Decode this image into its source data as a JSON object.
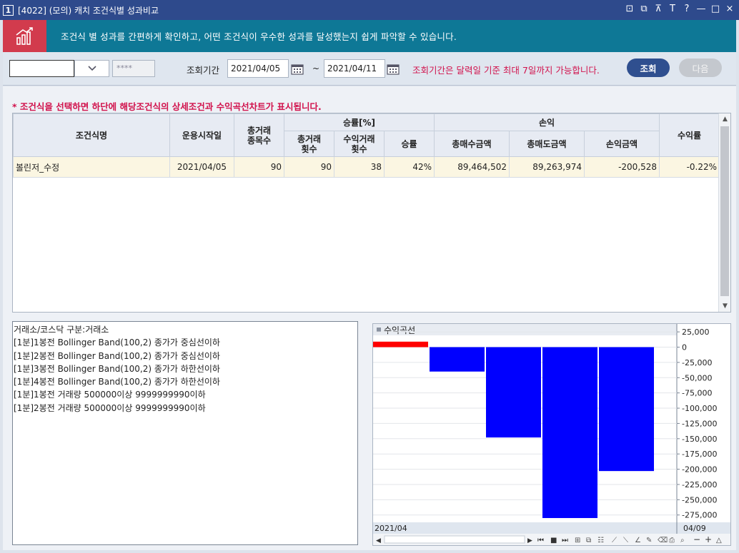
{
  "window": {
    "number": "1",
    "title": "[4022] (모의) 캐치 조건식별 성과비교",
    "controls": [
      "⊡",
      "⧉",
      "⊼",
      "T",
      "?",
      "—",
      "□",
      "×"
    ]
  },
  "banner": {
    "text": "조건식 별 성과를 간편하게 확인하고, 어떤 조건식이 우수한 성과를 달성했는지 쉽게 파악할 수 있습니다."
  },
  "toolbar": {
    "account_value": "",
    "password_mask": "****",
    "period_label": "조회기간",
    "date_from": "2021/04/05",
    "tilde": "~",
    "date_to": "2021/04/11",
    "note": "조회기간은 달력일 기준 최대 7일까지 가능합니다.",
    "query_button": "조회",
    "next_button": "다음"
  },
  "hint": "* 조건식을 선택하면 하단에 해당조건식의 상세조건과 수익곡선차트가 표시됩니다.",
  "table": {
    "headers": {
      "name": "조건식명",
      "start_date": "운용시작일",
      "total_items": "총거래\n종목수",
      "win_group": "승률[%]",
      "total_trades": "총거래\n횟수",
      "profit_trades": "수익거래\n횟수",
      "win_rate": "승률",
      "pnl_group": "손익",
      "total_buy": "총매수금액",
      "total_sell": "총매도금액",
      "pnl": "손익금액",
      "return": "수익률"
    },
    "rows": [
      [
        "볼린저_수정",
        "2021/04/05",
        "90",
        "90",
        "38",
        "42%",
        "89,464,502",
        "89,263,974",
        "-200,528",
        "-0.22%"
      ]
    ]
  },
  "conditions": [
    "거래소/코스닥 구분:거래소",
    "[1분]1봉전 Bollinger Band(100,2) 종가가 중심선이하",
    "[1분]2봉전 Bollinger Band(100,2) 종가가 중심선이하",
    "[1분]3봉전 Bollinger Band(100,2) 종가가 하한선이하",
    "[1분]4봉전 Bollinger Band(100,2) 종가가 하한선이하",
    "[1분]1봉전 거래량 500000이상 9999999990이하",
    "[1분]2봉전 거래량 500000이상 9999999990이하"
  ],
  "chart_data": {
    "type": "bar",
    "legend": "수익곡선",
    "values": [
      9000,
      -40000,
      -148000,
      -280000,
      -203000
    ],
    "colors": {
      "positive": "#ff0000",
      "negative": "#0000ff"
    },
    "ylim": [
      -287000,
      38000
    ],
    "yticks": [
      25000,
      0,
      -25000,
      -50000,
      -75000,
      -100000,
      -125000,
      -150000,
      -175000,
      -200000,
      -225000,
      -250000,
      -275000
    ],
    "ytick_labels": [
      "25,000",
      "0",
      "-25,000",
      "-50,000",
      "-75,000",
      "-100,000",
      "-125,000",
      "-150,000",
      "-175,000",
      "-200,000",
      "-225,000",
      "-250,000",
      "-275,000"
    ],
    "x_start_label": "2021/04",
    "x_end_label": "04/09",
    "grid": true
  }
}
